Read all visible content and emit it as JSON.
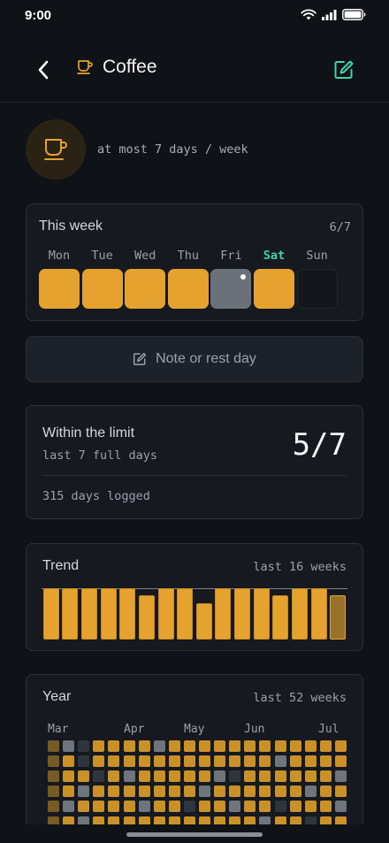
{
  "status": {
    "time": "9:00"
  },
  "nav": {
    "title": "Coffee"
  },
  "habit": {
    "goal": "at most 7 days / week",
    "icon": "coffee-cup-icon",
    "accent": "#e6a22f"
  },
  "week": {
    "title": "This week",
    "count": "6/7",
    "days": [
      {
        "label": "Mon",
        "state": "done"
      },
      {
        "label": "Tue",
        "state": "done"
      },
      {
        "label": "Wed",
        "state": "done"
      },
      {
        "label": "Thu",
        "state": "done"
      },
      {
        "label": "Fri",
        "state": "rest",
        "note": true
      },
      {
        "label": "Sat",
        "state": "done",
        "today": true
      },
      {
        "label": "Sun",
        "state": "empty"
      }
    ]
  },
  "note_button": {
    "label": "Note or rest day"
  },
  "limit": {
    "title": "Within the limit",
    "subtitle": "last 7 full days",
    "value": "5/7",
    "logged": "315 days logged"
  },
  "trend": {
    "title": "Trend",
    "range": "last 16 weeks"
  },
  "year": {
    "title": "Year",
    "range": "last 52 weeks",
    "months": [
      "Mar",
      "Apr",
      "May",
      "Jun",
      "Jul"
    ]
  },
  "chart_data": [
    {
      "type": "bar",
      "title": "Trend",
      "subtitle": "last 16 weeks",
      "values": [
        7,
        7,
        7,
        7,
        7,
        6,
        7,
        7,
        5,
        7,
        7,
        7,
        6,
        7,
        7,
        6
      ],
      "ylim": [
        0,
        7
      ],
      "limit_line": 7,
      "current_index": 15
    }
  ],
  "colors": {
    "background": "#0f1216",
    "card": "#161a20",
    "done": "#e6a22f",
    "rest": "#6b7179",
    "today": "#3fd3b0",
    "edit": "#3fd3b0"
  }
}
